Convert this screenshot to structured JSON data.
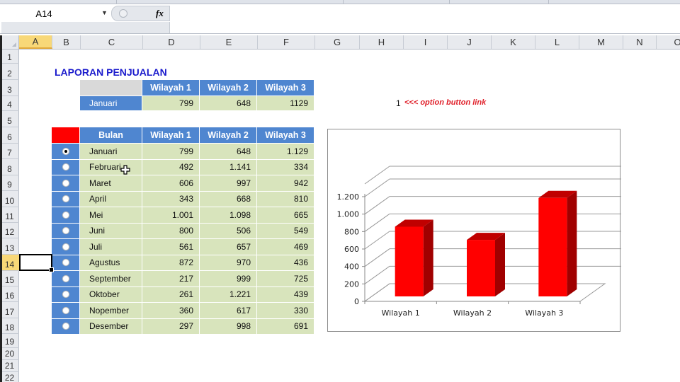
{
  "formula_bar": {
    "name_box": "A14",
    "fx_label": "fx",
    "formula": ""
  },
  "columns": [
    "A",
    "B",
    "C",
    "D",
    "E",
    "F",
    "G",
    "H",
    "I",
    "J",
    "K",
    "L",
    "M",
    "N",
    "O"
  ],
  "active_column": "A",
  "rows": [
    "1",
    "2",
    "3",
    "4",
    "5",
    "6",
    "7",
    "8",
    "9",
    "10",
    "11",
    "12",
    "13",
    "14",
    "15",
    "16",
    "17",
    "18",
    "19",
    "20",
    "21",
    "22"
  ],
  "active_row": "14",
  "report": {
    "title": "LAPORAN PENJUALAN",
    "summary": {
      "headers": [
        "Wilayah 1",
        "Wilayah 2",
        "Wilayah 3"
      ],
      "month": "Januari",
      "values": [
        "799",
        "648",
        "1129"
      ]
    },
    "link_value": "1",
    "link_note": "<<< option button link"
  },
  "table": {
    "headers": [
      "Bulan",
      "Wilayah 1",
      "Wilayah 2",
      "Wilayah 3"
    ],
    "selected_index": 0,
    "rows": [
      {
        "month": "Januari",
        "w1": "799",
        "w2": "648",
        "w3": "1.129"
      },
      {
        "month": "Februari",
        "w1": "492",
        "w2": "1.141",
        "w3": "334"
      },
      {
        "month": "Maret",
        "w1": "606",
        "w2": "997",
        "w3": "942"
      },
      {
        "month": "April",
        "w1": "343",
        "w2": "668",
        "w3": "810"
      },
      {
        "month": "Mei",
        "w1": "1.001",
        "w2": "1.098",
        "w3": "665"
      },
      {
        "month": "Juni",
        "w1": "800",
        "w2": "506",
        "w3": "549"
      },
      {
        "month": "Juli",
        "w1": "561",
        "w2": "657",
        "w3": "469"
      },
      {
        "month": "Agustus",
        "w1": "872",
        "w2": "970",
        "w3": "436"
      },
      {
        "month": "September",
        "w1": "217",
        "w2": "999",
        "w3": "725"
      },
      {
        "month": "Oktober",
        "w1": "261",
        "w2": "1.221",
        "w3": "439"
      },
      {
        "month": "Nopember",
        "w1": "360",
        "w2": "617",
        "w3": "330"
      },
      {
        "month": "Desember",
        "w1": "297",
        "w2": "998",
        "w3": "691"
      }
    ]
  },
  "colors": {
    "header_blue": "#4f86d0",
    "cell_green": "#d8e4bc",
    "bar_red": "#ff0000",
    "title_blue": "#1a1acc",
    "note_red": "#e0202a"
  },
  "chart_data": {
    "type": "bar",
    "style": "3d-column",
    "categories": [
      "Wilayah 1",
      "Wilayah 2",
      "Wilayah 3"
    ],
    "values": [
      799,
      648,
      1129
    ],
    "title": "",
    "xlabel": "",
    "ylabel": "",
    "ylim": [
      0,
      1200
    ],
    "yticks": [
      0,
      200,
      400,
      600,
      800,
      1000,
      1200
    ],
    "ytick_labels": [
      "0",
      "200",
      "400",
      "600",
      "800",
      "1.000",
      "1.200"
    ],
    "grid": true,
    "legend": "none"
  }
}
